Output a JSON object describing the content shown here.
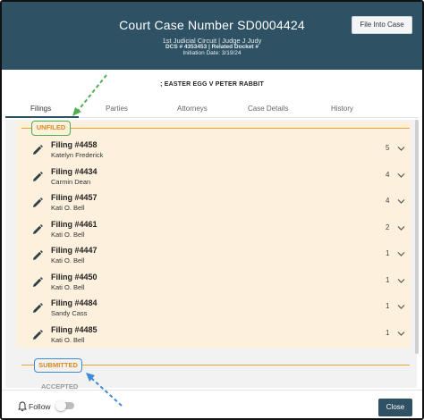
{
  "header": {
    "title": "Court Case Number SD0004424",
    "court_line": "1st Judicial Circuit | Judge J Judy",
    "dcs_line": "DCS # 4353453 | Related Docket #",
    "initiation_line": "Initiation Date: 3/19/24",
    "file_into_case_label": "File Into Case",
    "bg_color": "#2e5163"
  },
  "case_caption": "; EASTER EGG V PETER RABBIT",
  "tabs": [
    {
      "label": "Filings",
      "active": true
    },
    {
      "label": "Parties",
      "active": false
    },
    {
      "label": "Attorneys",
      "active": false
    },
    {
      "label": "Case Details",
      "active": false
    },
    {
      "label": "History",
      "active": false
    }
  ],
  "sections": {
    "unfiled": "UNFILED",
    "submitted": "SUBMITTED",
    "accepted": "ACCEPTED"
  },
  "filings": [
    {
      "number": "Filing #4458",
      "party": "Katelyn Frederick",
      "count": "5"
    },
    {
      "number": "Filing #4434",
      "party": "Carmin Dean",
      "count": "4"
    },
    {
      "number": "Filing #4457",
      "party": "Kati O. Bell",
      "count": "4"
    },
    {
      "number": "Filing #4461",
      "party": "Kati O. Bell",
      "count": "2"
    },
    {
      "number": "Filing #4447",
      "party": "Kati O. Bell",
      "count": "1"
    },
    {
      "number": "Filing #4450",
      "party": "Kati O. Bell",
      "count": "1"
    },
    {
      "number": "Filing #4484",
      "party": "Sandy Cass",
      "count": "1"
    },
    {
      "number": "Filing #4485",
      "party": "Kati O. Bell",
      "count": "1"
    }
  ],
  "footer": {
    "follow_label": "Follow",
    "close_label": "Close"
  },
  "colors": {
    "accent_orange": "#f0a232",
    "unfiled_bg": "#fdf0dc",
    "highlight_green": "#4caf50",
    "highlight_blue": "#3d8ad6"
  },
  "icons": {
    "edit": "pencil-icon",
    "expand": "chevron-down-icon",
    "follow": "bell-icon"
  }
}
